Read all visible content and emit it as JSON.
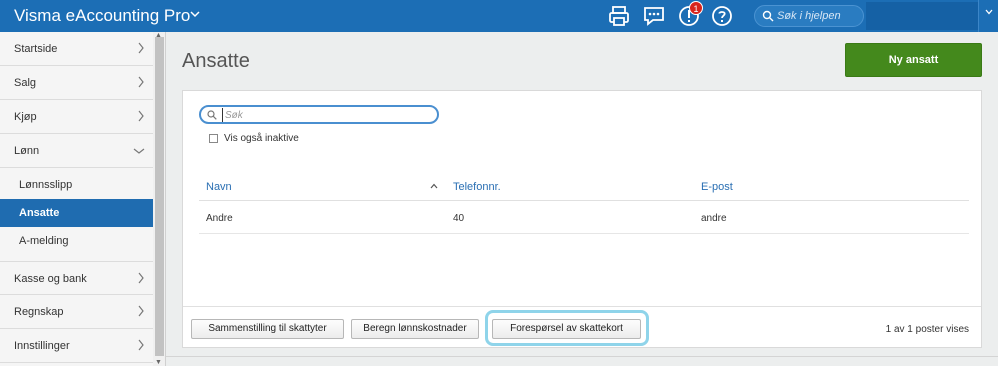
{
  "app": {
    "title": "Visma eAccounting Pro"
  },
  "topbar": {
    "notification_count": "1",
    "help_search_placeholder": "Søk i hjelpen",
    "icons": [
      "print-icon",
      "chat-icon",
      "notification-icon",
      "help-icon",
      "search-icon",
      "chevron-down-icon"
    ]
  },
  "sidebar": {
    "items": [
      {
        "label": "Startside"
      },
      {
        "label": "Salg"
      },
      {
        "label": "Kjøp"
      },
      {
        "label": "Lønn"
      },
      {
        "label": "Lønnsslipp"
      },
      {
        "label": "Ansatte"
      },
      {
        "label": "A-melding"
      },
      {
        "label": "Kasse og bank"
      },
      {
        "label": "Regnskap"
      },
      {
        "label": "Innstillinger"
      }
    ],
    "active": "Ansatte"
  },
  "main": {
    "title": "Ansatte",
    "new_button": "Ny ansatt",
    "search_placeholder": "Søk",
    "show_inactive_label": "Vis også inaktive",
    "show_inactive_checked": false,
    "columns": [
      "Navn",
      "Telefonnr.",
      "E-post"
    ],
    "rows": [
      {
        "name": "Andre",
        "phone": "40",
        "email": "andre"
      }
    ],
    "footer": {
      "buttons": [
        "Sammenstilling til skattyter",
        "Beregn lønnskostnader",
        "Forespørsel av skattekort"
      ],
      "count_text": "1 av 1 poster vises"
    }
  },
  "colors": {
    "topbar": "#1c6eb5",
    "active_nav": "#1f6cb0",
    "primary_button": "#44891c",
    "link": "#2a6fb3",
    "highlight": "#8fd4ea"
  }
}
